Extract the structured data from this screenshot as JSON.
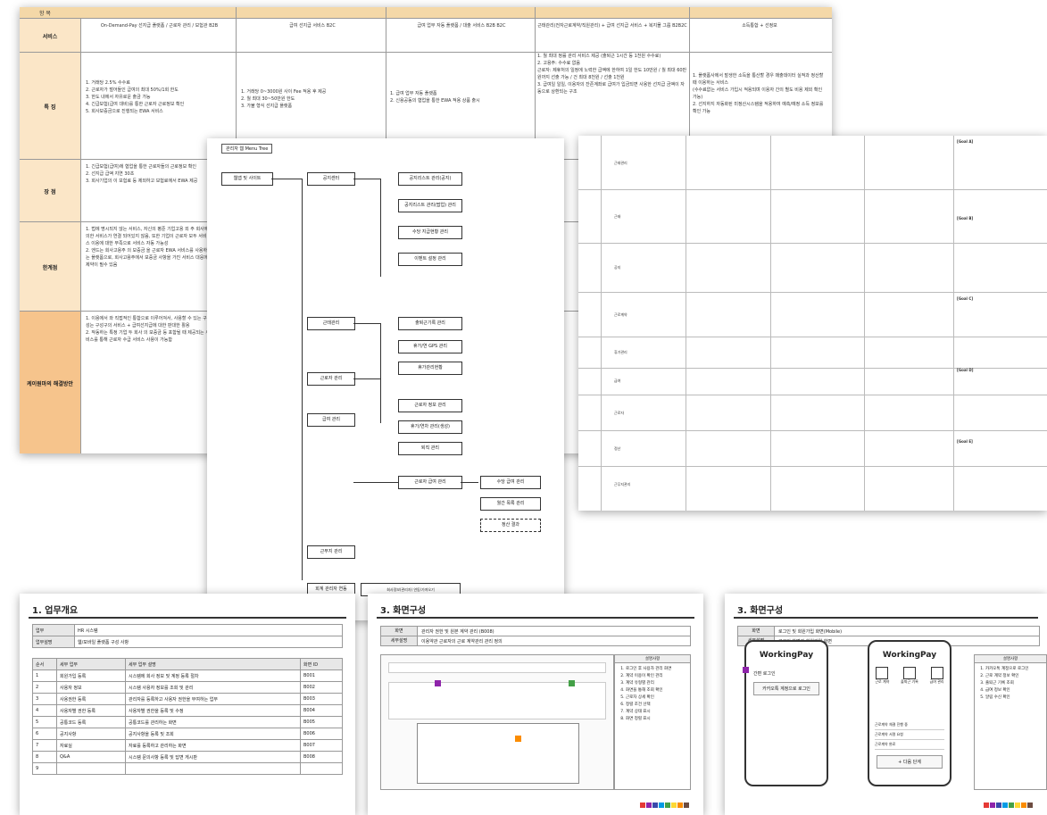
{
  "compare_doc": {
    "header_cols": [
      "항 목",
      "",
      "",
      "",
      "",
      ""
    ],
    "col_titles": [
      "서비스",
      "On-Demand-Pay 선지급 플랫폼 / 근로자 관리 / 보험관 B2B",
      "급여 선지급 서비스 B2C",
      "급여 업무 자동 플랫폼 / 대출 서비스 B2B B2C",
      "근태관리(전자근로계약/직원관리) + 급여 선지급 서비스 + 복지몰 그룹 B2B2C",
      "소득통합 + 선정보"
    ],
    "rows": [
      {
        "label": "특 징",
        "cells": [
          "1. 거래당 2.5% 수수료\n2. 근로자가 벌어들인 급여의 최대 50%/1회 한도\n3. 한도 내에서 자유로운 출금 가능\n4. 긴급보험(급여 대비)를 통한 근로자 근로정보 확인\n5. 회사보증금으로 진행되는 EWA 서비스",
          "1. 거래당 0~3000원 사이 Fee 적용 후 제공\n2. 월 최대 30~50만원 한도\n3. 가불 형식 선지급 플랫폼",
          "1. 급여 업무 자동 플랫폼\n2. 신용공동의 협업을 통한 EWA 적용 상품 출시",
          "1. 월 최대 정률 관리 서비스 제공 (출퇴근 1시간 등 1천원 수수료)\n2. 고용주: 수수료 없음\n근로자: 제휴처의 일정에 노력한 급액에 한하여 1일 한도 10만원 / 월 최대 60만원까지 선출 가능 / 건 최대 8천원 / 선출 1천원\n3. 급여일 일일, 이용자의 잔존계좌로 급여가 입금되면 사용한 선지급 금액이 자동으로 상환되는 구조",
          "1. 플랫폼사에서 발생한 소득을 통산할 경우 매출데이터 실적과 정산할 때 이용하는 서비스\n(수수료없는 서비스 가입시 적용되며 이용자 간의 별도 비용 제외 확인 가능)\n2. 선지하지 자동화된 미정산시스템을 적용하여 예측/예정 소득 정보를 확인 가능"
        ]
      },
      {
        "label": "장 점",
        "cells": [
          "1. 긴급보험(급여)에 협업을 통한 근로자들의 근로정보 확인\n2. 선지급 급액 지연 30초\n3. 회사기업의 이 보험료 등 제외하고 보험료에서 EWA 제공",
          "",
          "",
          "",
          ""
        ]
      },
      {
        "label": "한계점",
        "cells": [
          "1. 법에 명시되지 않는 서비스, 자신의 평준 기업고용 외 주 회사에 의한 서비스가 연결 되어있지 않음, 또한 기업이 근로자 모두 서비스 이용에 대한 부족으로 서비스 자동 가능성\n2. 엔드는 회사고용주 의 보증금 을 근로자 EWA 서비스를 사용하는 플랫폼으로, 회사고용주에서 보증금 사항을 가진 서비스 대응에 제약이 필수 있음",
          "",
          "",
          "",
          ""
        ]
      },
      {
        "label": "케이원마의 해결방안",
        "cells": [
          "1. 이용에서 와 직접적인 통합으로 이루어져서, 사용할 수 있는 구성는 구성구의 서비스 + 급여선지급에 대한 판대한 활용\n2. 작동하는 특정 기업 두 회사 의 보증금 등 포함될 때 제공되는 서비스를 통해 근로자 수급 서비스 사용이 가능함",
          "",
          "",
          "",
          ""
        ]
      }
    ]
  },
  "menu_tree": {
    "title": "관리자 웹 Menu Tree",
    "root": "웹앱 및 사이트",
    "level1": [
      "공지센터",
      "근태관리",
      "근로자 관리",
      "급여 관리",
      "근무지 관리",
      "회계 관리자 연동"
    ],
    "level2": [
      "공지리스트 관리(공지)",
      "공지리스트 관리(팝업) 관리",
      "수당 지급현황 관리",
      "이벤트 설정 관리",
      "출퇴근기록 관리",
      "휴가/연 GPS 관리",
      "휴가관리현황",
      "근로자 정보 관리",
      "휴가/연차 관리(생성)",
      "퇴직 관리",
      "근로자 급여 관리"
    ],
    "level3": [
      "수당 급여 관리",
      "월간 목록 관리",
      "정산 결과"
    ],
    "note": "회사정보(관리자) 연동/가져오기"
  },
  "detail_doc": {
    "rows": [
      "근태관리",
      "근태",
      "공지",
      "근로계약",
      "휴가관리",
      "급여",
      "근로자",
      "정산",
      "근무지관리"
    ],
    "notes": [
      "[Goal A]",
      "[Goal B]",
      "[Goal C]",
      "[Goal D]",
      "[Goal E]"
    ]
  },
  "slide1": {
    "title": "1. 업무개요",
    "info": [
      [
        "업무",
        "HR 시스템"
      ],
      [
        "업무설명",
        "웹/모바일 플랫폼 구성 사항"
      ]
    ],
    "table_headers": [
      "순서",
      "세부 업무",
      "세부 업무 설명",
      "화면 ID"
    ],
    "table_rows": [
      [
        "1",
        "회원가입 등록",
        "시스템에 회사 정보 및 계정 등록 절차",
        "B001"
      ],
      [
        "2",
        "사용자 정보",
        "시스템 사용자 정보를 조회 및 관리",
        "B002"
      ],
      [
        "3",
        "사용권한 등록",
        "관리자를 등록하고 사용자 권한을 부여하는 업무",
        "B003"
      ],
      [
        "4",
        "사용자별 권한 등록",
        "사용자별 권한을 등록 및 수정",
        "B004"
      ],
      [
        "5",
        "공통코드 등록",
        "공통코드를 관리하는 화면",
        "B005"
      ],
      [
        "6",
        "공지사항",
        "공지사항을 등록 및 조회",
        "B006"
      ],
      [
        "7",
        "자료실",
        "자료를 등록하고 관리하는 화면",
        "B007"
      ],
      [
        "8",
        "Q&A",
        "시스템 문의사항 등록 및 답변 게시판",
        "B008"
      ],
      [
        "9",
        "",
        "",
        ""
      ]
    ]
  },
  "slide2": {
    "title": "3. 화면구성",
    "header_rows": [
      [
        "화면",
        "관리자 권한 및 원본 계약 관리 (B008)"
      ],
      [
        "세부설명",
        "이용약관 근로자의 근로 계약관리 관리 정의"
      ]
    ],
    "desc_title": "설명사항",
    "desc_items": [
      "로그인 후 사용자 관리 화면",
      "계약 이용이 확인 관리",
      "계약 유형별 관리",
      "화면을 통해 조회 확인",
      "근로자 상세 확인",
      "정렬 조건 선택",
      "계약 상태 표시",
      "화면 정렬 표시"
    ]
  },
  "slide3": {
    "title": "3. 화면구성",
    "header_rows": [
      [
        "화면",
        "로그인 및 회원가입 화면(Mobile)"
      ],
      [
        "세부설명",
        "로그인 화면과 회원가입 화면"
      ]
    ],
    "phone_brand": "WorkingPay",
    "login_label": "간편 로그인",
    "kakao_button": "카카오톡 계정으로 로그인",
    "menu_labels": [
      "근로 계약",
      "출퇴근 기록",
      "급여 관리",
      "알림"
    ],
    "contract_items": [
      "근로계약 체결 진행 중",
      "근로계약 서명 요청",
      "근로계약 완료"
    ],
    "next_button": "+ 다음 단계",
    "desc_title": "설명사항",
    "desc_items": [
      "카카오톡 계정으로 로그인",
      "근로 계약 정보 확인",
      "출퇴근 기록 조회",
      "급여 정보 확인",
      "알림 수신 확인"
    ]
  },
  "colors": [
    "#e53935",
    "#8e24aa",
    "#3949ab",
    "#039be5",
    "#43a047",
    "#fdd835",
    "#fb8c00",
    "#6d4c41"
  ]
}
